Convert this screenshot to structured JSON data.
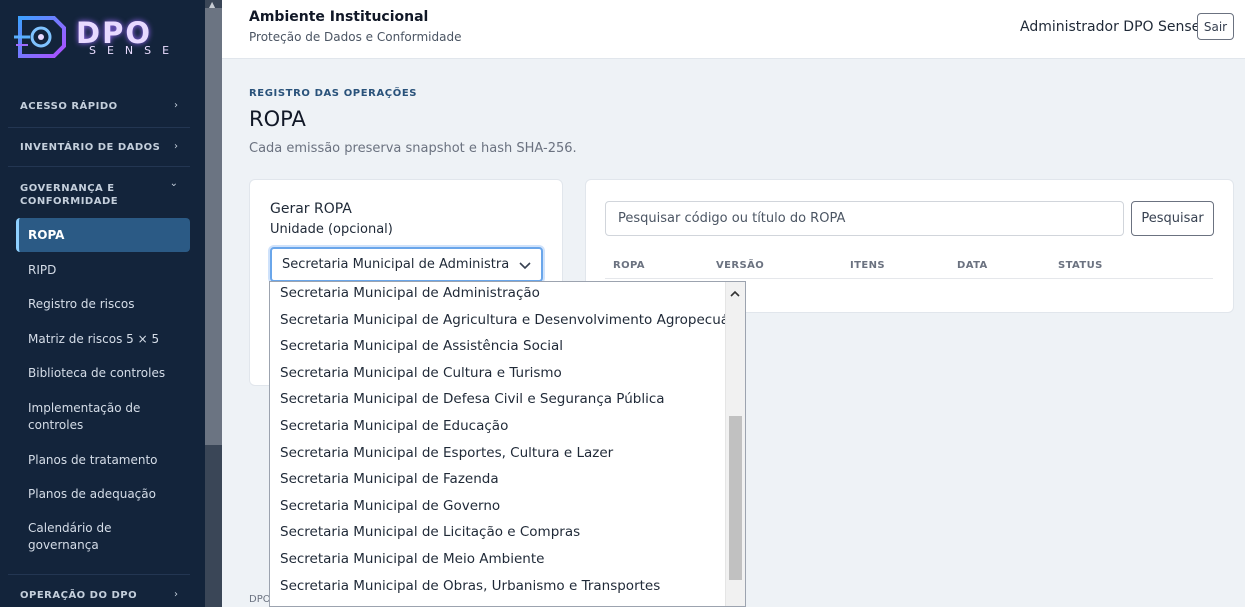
{
  "brand": {
    "logo_line1": "DPO",
    "logo_line2": "SENSE",
    "accent": "#9d6bff"
  },
  "sidebar": {
    "sections": [
      {
        "title": "ACESSO RÁPIDO",
        "chevron": "›"
      },
      {
        "title": "INVENTÁRIO DE DADOS",
        "chevron": "›"
      },
      {
        "title": "GOVERNANÇA E CONFORMIDADE",
        "chevron": "⌄"
      },
      {
        "title": "OPERAÇÃO DO DPO",
        "chevron": "›"
      }
    ],
    "items": [
      {
        "label": "ROPA",
        "active": true
      },
      {
        "label": "RIPD"
      },
      {
        "label": "Registro de riscos"
      },
      {
        "label": "Matriz de riscos 5 × 5"
      },
      {
        "label": "Biblioteca de controles"
      },
      {
        "label": "Implementação de controles"
      },
      {
        "label": "Planos de tratamento"
      },
      {
        "label": "Planos de adequação"
      },
      {
        "label": "Calendário de governança"
      }
    ],
    "active_color": "#2b5a85"
  },
  "header": {
    "title": "Ambiente Institucional",
    "subtitle": "Proteção de Dados e Conformidade",
    "user": "Administrador DPO Sense",
    "logout": "Sair"
  },
  "main": {
    "eyebrow": "REGISTRO DAS OPERAÇÕES",
    "title": "ROPA",
    "description": "Cada emissão preserva snapshot e hash SHA-256.",
    "footer_partial": "DPO"
  },
  "generate": {
    "title": "Gerar ROPA",
    "unit_label": "Unidade (opcional)",
    "unit_selected": "Secretaria Municipal de Administração"
  },
  "search": {
    "placeholder": "Pesquisar código ou título do ROPA",
    "button": "Pesquisar",
    "columns": [
      "ROPA",
      "VERSÃO",
      "ITENS",
      "DATA",
      "STATUS"
    ]
  },
  "dropdown": {
    "options": [
      "Secretaria Municipal de Administração",
      "Secretaria Municipal de Agricultura e Desenvolvimento Agropecuários",
      "Secretaria Municipal de Assistência Social",
      "Secretaria Municipal de Cultura e Turismo",
      "Secretaria Municipal de Defesa Civil e Segurança Pública",
      "Secretaria Municipal de Educação",
      "Secretaria Municipal de Esportes, Cultura e Lazer",
      "Secretaria Municipal de Fazenda",
      "Secretaria Municipal de Governo",
      "Secretaria Municipal de Licitação e Compras",
      "Secretaria Municipal de Meio Ambiente",
      "Secretaria Municipal de Obras, Urbanismo e Transportes"
    ]
  }
}
